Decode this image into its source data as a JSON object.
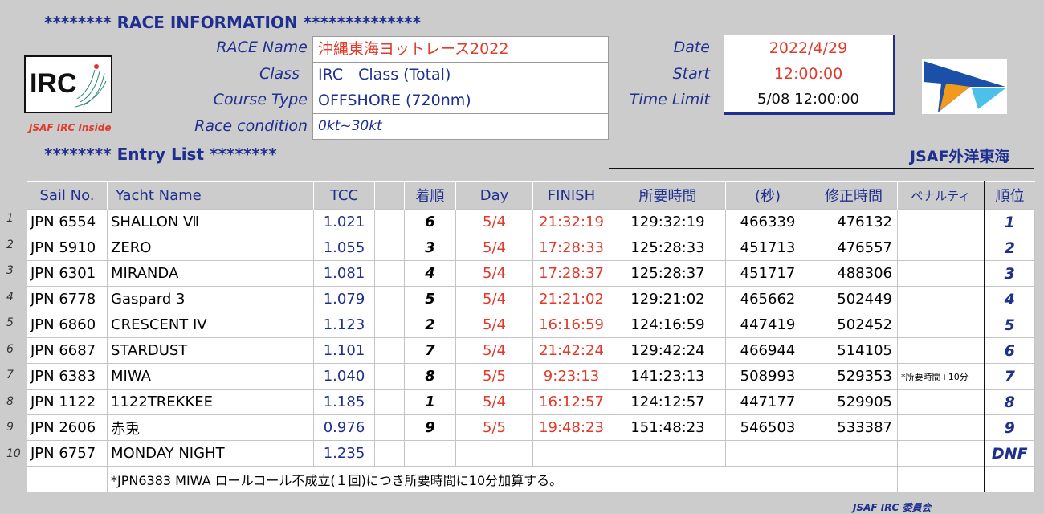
{
  "header": {
    "race_info_title": "******** RACE INFORMATION **************",
    "entry_list_title": "******** Entry List ********",
    "org_name": "JSAF外洋東海",
    "irc_caption": "JSAF IRC Inside",
    "footer": "JSAF IRC 委員会"
  },
  "info": {
    "race_name_label": "RACE Name",
    "race_name": "沖縄東海ヨットレース2022",
    "class_label": "Class",
    "class_value": "IRC　Class (Total)",
    "course_label": "Course Type",
    "course_value": "OFFSHORE (720nm)",
    "condition_label": "Race condition",
    "condition_value": "0kt~30kt",
    "date_label": "Date",
    "date_value": "2022/4/29",
    "start_label": "Start",
    "start_value": "12:00:00",
    "limit_label": "Time Limit",
    "limit_value": "5/08 12:00:00"
  },
  "table": {
    "headers": [
      "Sail No.",
      "Yacht Name",
      "TCC",
      "",
      "着順",
      "Day",
      "FINISH",
      "所要時間",
      "(秒)",
      "修正時間",
      "ペナルティ",
      "順位"
    ],
    "rows": [
      {
        "num": "1",
        "sail": "JPN 6554",
        "yacht": "SHALLON Ⅶ",
        "tcc": "1.021",
        "place": "6",
        "day": "5/4",
        "finish": "21:32:19",
        "elapsed": "129:32:19",
        "secs": "466339",
        "corrected": "476132",
        "penalty": "",
        "rank": "1"
      },
      {
        "num": "2",
        "sail": "JPN 5910",
        "yacht": "ZERO",
        "tcc": "1.055",
        "place": "3",
        "day": "5/4",
        "finish": "17:28:33",
        "elapsed": "125:28:33",
        "secs": "451713",
        "corrected": "476557",
        "penalty": "",
        "rank": "2"
      },
      {
        "num": "3",
        "sail": "JPN 6301",
        "yacht": "MIRANDA",
        "tcc": "1.081",
        "place": "4",
        "day": "5/4",
        "finish": "17:28:37",
        "elapsed": "125:28:37",
        "secs": "451717",
        "corrected": "488306",
        "penalty": "",
        "rank": "3"
      },
      {
        "num": "4",
        "sail": "JPN 6778",
        "yacht": "Gaspard 3",
        "tcc": "1.079",
        "place": "5",
        "day": "5/4",
        "finish": "21:21:02",
        "elapsed": "129:21:02",
        "secs": "465662",
        "corrected": "502449",
        "penalty": "",
        "rank": "4"
      },
      {
        "num": "5",
        "sail": "JPN 6860",
        "yacht": "CRESCENT IV",
        "tcc": "1.123",
        "place": "2",
        "day": "5/4",
        "finish": "16:16:59",
        "elapsed": "124:16:59",
        "secs": "447419",
        "corrected": "502452",
        "penalty": "",
        "rank": "5"
      },
      {
        "num": "6",
        "sail": "JPN 6687",
        "yacht": "STARDUST",
        "tcc": "1.101",
        "place": "7",
        "day": "5/4",
        "finish": "21:42:24",
        "elapsed": "129:42:24",
        "secs": "466944",
        "corrected": "514105",
        "penalty": "",
        "rank": "6"
      },
      {
        "num": "7",
        "sail": "JPN 6383",
        "yacht": "MIWA",
        "tcc": "1.040",
        "place": "8",
        "day": "5/5",
        "finish": "9:23:13",
        "elapsed": "141:23:13",
        "secs": "508993",
        "corrected": "529353",
        "penalty": "*所要時間+10分",
        "rank": "7"
      },
      {
        "num": "8",
        "sail": "JPN 1122",
        "yacht": "1122TREKKEE",
        "tcc": "1.185",
        "place": "1",
        "day": "5/4",
        "finish": "16:12:57",
        "elapsed": "124:12:57",
        "secs": "447177",
        "corrected": "529905",
        "penalty": "",
        "rank": "8"
      },
      {
        "num": "9",
        "sail": "JPN 2606",
        "yacht": "赤兎",
        "tcc": "0.976",
        "place": "9",
        "day": "5/5",
        "finish": "19:48:23",
        "elapsed": "151:48:23",
        "secs": "546503",
        "corrected": "533387",
        "penalty": "",
        "rank": "9"
      },
      {
        "num": "10",
        "sail": "JPN 6757",
        "yacht": "MONDAY NIGHT",
        "tcc": "1.235",
        "place": "",
        "day": "",
        "finish": "",
        "elapsed": "",
        "secs": "",
        "corrected": "",
        "penalty": "",
        "rank": "DNF"
      }
    ],
    "note": "*JPN6383 MIWA ロールコール不成立(１回)につき所要時間に10分加算する。"
  },
  "colors": {
    "background": "#cccccc",
    "navy": "#1f2f8f",
    "red": "#e03a2a"
  }
}
